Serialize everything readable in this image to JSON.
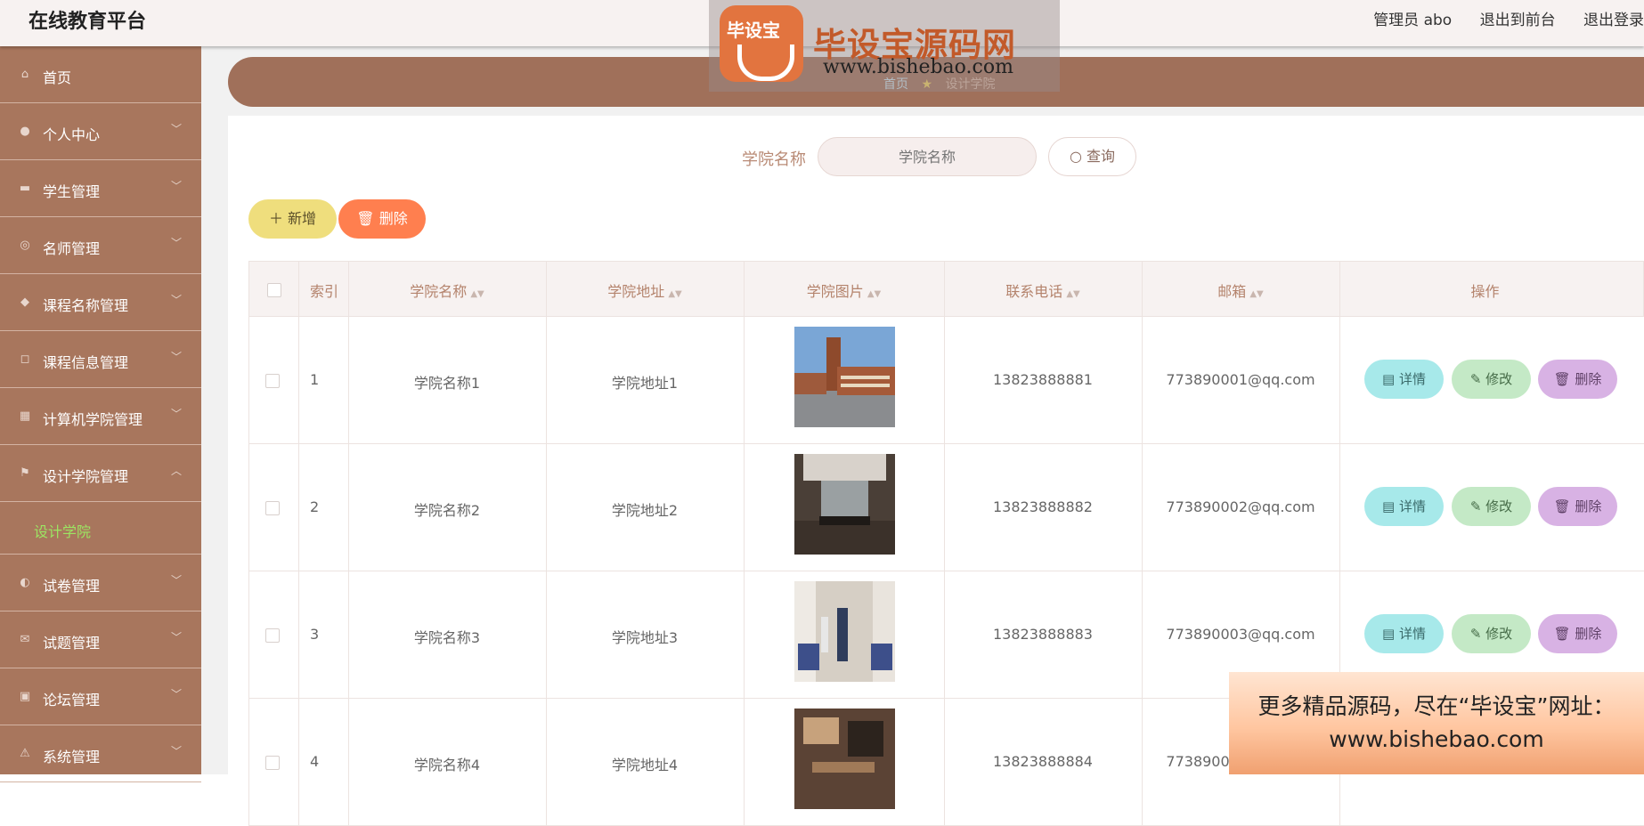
{
  "app": {
    "title": "在线教育平台"
  },
  "header": {
    "links": [
      "管理员 abo",
      "退出到前台",
      "退出登录"
    ]
  },
  "sidebar": {
    "items": [
      {
        "label": "首页",
        "icon": "home-icon",
        "glyph": "⌂",
        "has_chevron": false
      },
      {
        "label": "个人中心",
        "icon": "user-icon",
        "glyph": "●",
        "has_chevron": true
      },
      {
        "label": "学生管理",
        "icon": "monitor-icon",
        "glyph": "▬",
        "has_chevron": true
      },
      {
        "label": "名师管理",
        "icon": "compass-icon",
        "glyph": "◎",
        "has_chevron": true
      },
      {
        "label": "课程名称管理",
        "icon": "bulb-icon",
        "glyph": "◆",
        "has_chevron": true
      },
      {
        "label": "课程信息管理",
        "icon": "crop-icon",
        "glyph": "◻",
        "has_chevron": true
      },
      {
        "label": "计算机学院管理",
        "icon": "grid-icon",
        "glyph": "▦",
        "has_chevron": true
      },
      {
        "label": "设计学院管理",
        "icon": "flag-icon",
        "glyph": "⚑",
        "has_chevron": true,
        "expanded": true,
        "subitems": [
          {
            "label": "设计学院",
            "active": true
          }
        ]
      },
      {
        "label": "试卷管理",
        "icon": "power-icon",
        "glyph": "◐",
        "has_chevron": true
      },
      {
        "label": "试题管理",
        "icon": "message-icon",
        "glyph": "✉",
        "has_chevron": true
      },
      {
        "label": "论坛管理",
        "icon": "clipboard-icon",
        "glyph": "▣",
        "has_chevron": true
      },
      {
        "label": "系统管理",
        "icon": "alert-icon",
        "glyph": "⚠",
        "has_chevron": true
      }
    ]
  },
  "breadcrumb": {
    "home": "首页",
    "current": "设计学院"
  },
  "search": {
    "label": "学院名称",
    "placeholder": "学院名称",
    "query_button": "查询"
  },
  "actions": {
    "add_label": "新增",
    "delete_label": "删除"
  },
  "table": {
    "columns": [
      "索引",
      "学院名称",
      "学院地址",
      "学院图片",
      "联系电话",
      "邮箱",
      "操作"
    ],
    "rows": [
      {
        "index": "1",
        "name": "学院名称1",
        "address": "学院地址1",
        "phone": "13823888881",
        "email": "773890001@qq.com"
      },
      {
        "index": "2",
        "name": "学院名称2",
        "address": "学院地址2",
        "phone": "13823888882",
        "email": "773890002@qq.com"
      },
      {
        "index": "3",
        "name": "学院名称3",
        "address": "学院地址3",
        "phone": "13823888883",
        "email": "773890003@qq.com"
      },
      {
        "index": "4",
        "name": "学院名称4",
        "address": "学院地址4",
        "phone": "13823888884",
        "email": "773890004@qq.com"
      }
    ],
    "row_actions": {
      "detail": "详情",
      "edit": "修改",
      "delete": "删除"
    }
  },
  "promo": {
    "line1": "更多精品源码，尽在“毕设宝”网址：",
    "line2": "www.bishebao.com"
  },
  "watermark": {
    "logo_text": "毕设宝",
    "title": "毕设宝源码网",
    "url": "www.bishebao.com"
  }
}
